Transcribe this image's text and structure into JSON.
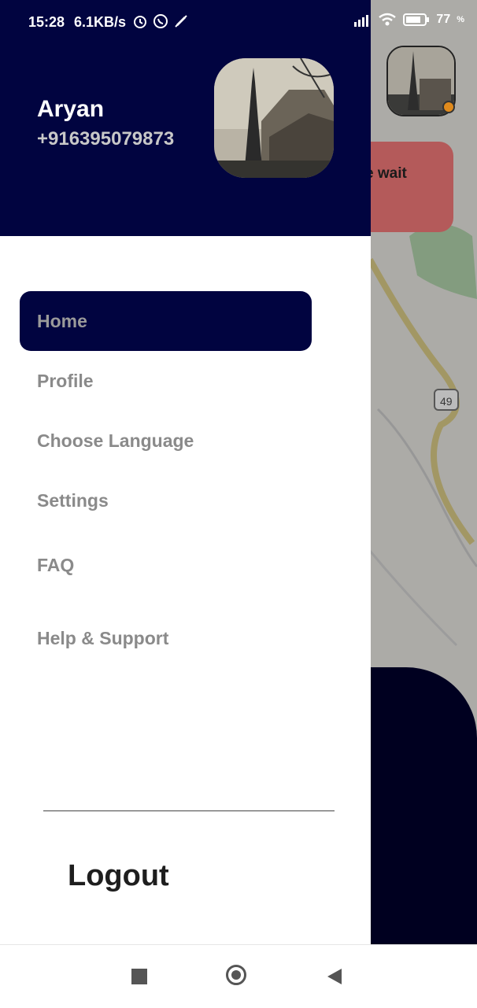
{
  "status_bar": {
    "time": "15:28",
    "speed": "6.1KB/s",
    "battery": "77",
    "icons": [
      "alarm-icon",
      "whatsapp-icon",
      "mute-icon",
      "signal-icon",
      "wifi-icon",
      "battery-icon"
    ]
  },
  "drawer": {
    "user_name": "Aryan",
    "user_phone": "+916395079873",
    "menu": [
      {
        "label": "Home",
        "active": true
      },
      {
        "label": "Profile",
        "active": false
      },
      {
        "label": "Choose Language",
        "active": false
      },
      {
        "label": "Settings",
        "active": false
      },
      {
        "label": "FAQ",
        "active": false
      },
      {
        "label": "Help & Support",
        "active": false
      }
    ],
    "logout_label": "Logout"
  },
  "background": {
    "banner_text": "e wait",
    "road_badge": "49"
  },
  "colors": {
    "drawer_header": "#010440",
    "active_item": "#010440",
    "menu_text": "#8a8a8a"
  }
}
